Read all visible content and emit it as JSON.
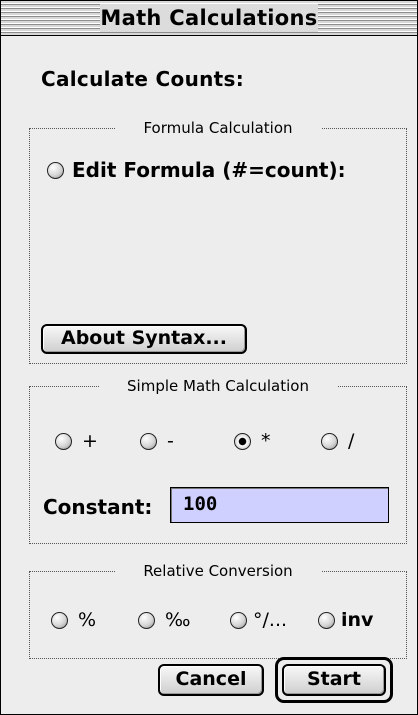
{
  "window": {
    "title": "Math Calculations"
  },
  "heading": "Calculate Counts:",
  "formula_group": {
    "legend": "Formula Calculation",
    "edit_formula_label": "Edit Formula (#=count):",
    "about_syntax_label": "About Syntax..."
  },
  "simple_math_group": {
    "legend": "Simple Math Calculation",
    "operators": [
      {
        "label": "+",
        "checked": false
      },
      {
        "label": "-",
        "checked": false
      },
      {
        "label": "*",
        "checked": true
      },
      {
        "label": "/",
        "checked": false
      }
    ],
    "constant_label": "Constant:",
    "constant_value": "100"
  },
  "relative_group": {
    "legend": "Relative Conversion",
    "options": [
      {
        "label": "%",
        "checked": false
      },
      {
        "label": "‰",
        "checked": false
      },
      {
        "label": "°/...",
        "checked": false
      },
      {
        "label": "inv",
        "checked": false
      }
    ]
  },
  "buttons": {
    "cancel": "Cancel",
    "start": "Start"
  }
}
